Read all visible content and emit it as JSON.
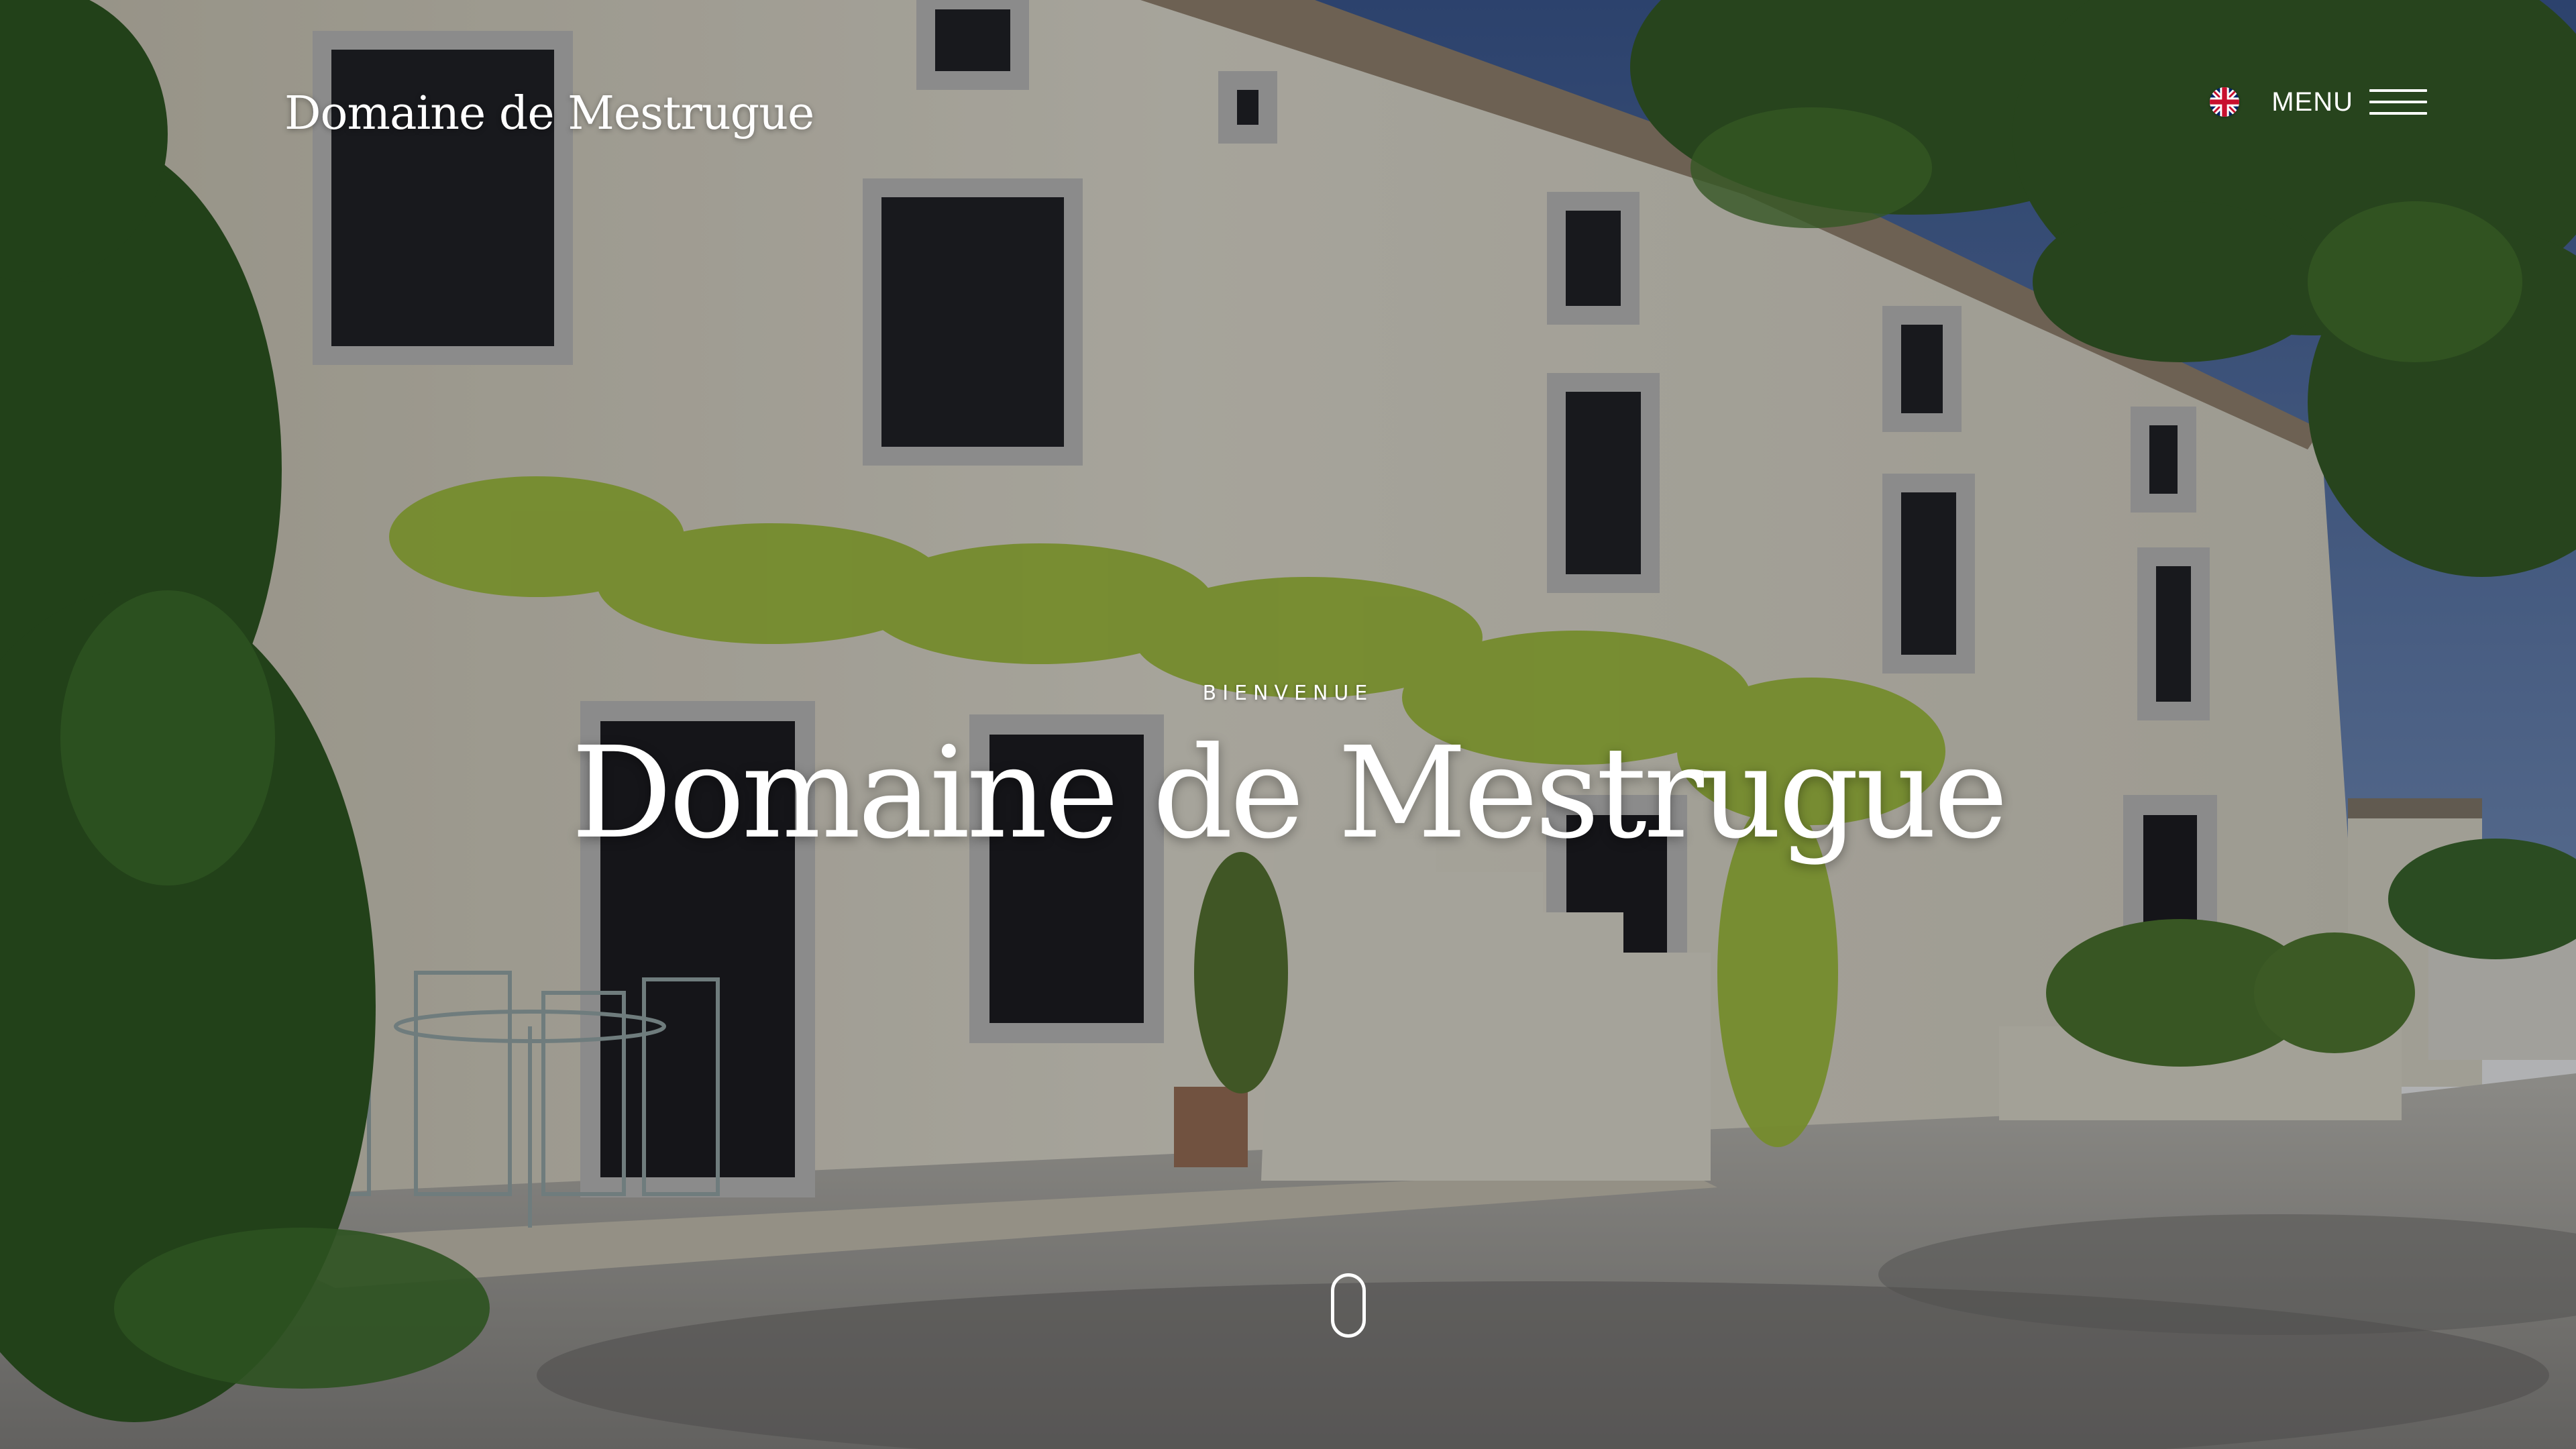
{
  "header": {
    "brand": "Domaine de Mestrugue",
    "language_icon": "uk-flag-icon",
    "menu_label": "MENU",
    "menu_icon": "hamburger-icon"
  },
  "hero": {
    "eyebrow": "BIENVENUE",
    "title": "Domaine de Mestrugue",
    "scroll_icon": "mouse-scroll-icon"
  },
  "colors": {
    "text": "#ffffff",
    "wall": "#ece6d2",
    "sky": "#3f5f9a",
    "foliage": "#a9c83a"
  }
}
